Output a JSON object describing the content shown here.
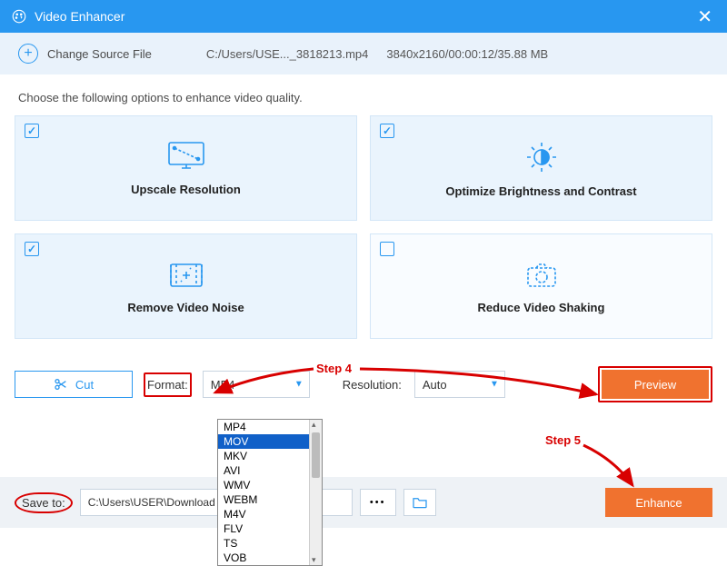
{
  "window": {
    "title": "Video Enhancer"
  },
  "source": {
    "change_label": "Change Source File",
    "path": "C:/Users/USE..._3818213.mp4",
    "info": "3840x2160/00:00:12/35.88 MB"
  },
  "instruction": "Choose the following options to enhance video quality.",
  "cards": {
    "upscale": {
      "label": "Upscale Resolution",
      "checked": true
    },
    "brightness": {
      "label": "Optimize Brightness and Contrast",
      "checked": true
    },
    "noise": {
      "label": "Remove Video Noise",
      "checked": true
    },
    "shaking": {
      "label": "Reduce Video Shaking",
      "checked": false
    }
  },
  "controls": {
    "cut": "Cut",
    "format_label": "Format:",
    "format_value": "MP4",
    "resolution_label": "Resolution:",
    "resolution_value": "Auto",
    "preview": "Preview"
  },
  "format_options": [
    "MP4",
    "MOV",
    "MKV",
    "AVI",
    "WMV",
    "WEBM",
    "M4V",
    "FLV",
    "TS",
    "VOB"
  ],
  "format_highlight": "MOV",
  "bottom": {
    "saveto": "Save to:",
    "path": "C:\\Users\\USER\\Download",
    "enhance": "Enhance"
  },
  "annotations": {
    "step4": "Step 4",
    "step5": "Step 5"
  }
}
